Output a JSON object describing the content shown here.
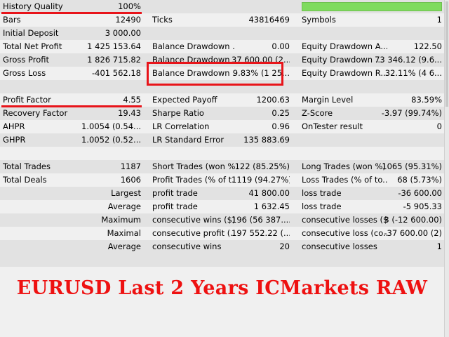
{
  "rows": [
    {
      "c1": "History Quality",
      "v1": "100%"
    },
    {
      "c1": "Bars",
      "v1": "12490",
      "c2": "Ticks",
      "v2": "43816469",
      "c3": "Symbols",
      "v3": "1"
    },
    {
      "c1": "Initial Deposit",
      "v1": "3 000.00"
    },
    {
      "c1": "Total Net Profit",
      "v1": "1 425 153.64",
      "c2": "Balance Drawdown ...",
      "v2": "0.00",
      "c3": "Equity Drawdown A...",
      "v3": "122.50"
    },
    {
      "c1": "Gross Profit",
      "v1": "1 826 715.82",
      "c2": "Balance Drawdown ...",
      "v2": "37 600.00 (2...",
      "c3": "Equity Drawdown ...",
      "v3": "73 346.12 (9.6..."
    },
    {
      "c1": "Gross Loss",
      "v1": "-401 562.18",
      "c2": "Balance Drawdown ...",
      "v2": "9.83% (1 25...",
      "c3": "Equity Drawdown R...",
      "v3": "32.11% (4 6..."
    },
    {},
    {
      "c1": "Profit Factor",
      "v1": "4.55",
      "c2": "Expected Payoff",
      "v2": "1200.63",
      "c3": "Margin Level",
      "v3": "83.59%"
    },
    {
      "c1": "Recovery Factor",
      "v1": "19.43",
      "c2": "Sharpe Ratio",
      "v2": "0.25",
      "c3": "Z-Score",
      "v3": "-3.97 (99.74%)"
    },
    {
      "c1": "AHPR",
      "v1": "1.0054 (0.54...",
      "c2": "LR Correlation",
      "v2": "0.96",
      "c3": "OnTester result",
      "v3": "0"
    },
    {
      "c1": "GHPR",
      "v1": "1.0052 (0.52...",
      "c2": "LR Standard Error",
      "v2": "135 883.69"
    },
    {},
    {
      "c1": "Total Trades",
      "v1": "1187",
      "c2": "Short Trades (won %)",
      "v2": "122 (85.25%)",
      "c3": "Long Trades (won %)",
      "v3": "1065 (95.31%)"
    },
    {
      "c1": "Total Deals",
      "v1": "1606",
      "c2": "Profit Trades (% of t...",
      "v2": "1119 (94.27%)",
      "c3": "Loss Trades (% of to...",
      "v3": "68 (5.73%)"
    },
    {
      "v1": "Largest",
      "c2": "profit trade",
      "v2": "41 800.00",
      "c3": "loss trade",
      "v3": "-36 600.00"
    },
    {
      "v1": "Average",
      "c2": "profit trade",
      "v2": "1 632.45",
      "c3": "loss trade",
      "v3": "-5 905.33"
    },
    {
      "v1": "Maximum",
      "c2": "consecutive wins ($)",
      "v2": "196 (56 387....",
      "c3": "consecutive losses ($)",
      "v3": "3 (-12 600.00)"
    },
    {
      "v1": "Maximal",
      "c2": "consecutive profit (...",
      "v2": "197 552.22 (...",
      "c3": "consecutive loss (co...",
      "v3": "-37 600.00 (2)"
    },
    {
      "v1": "Average",
      "c2": "consecutive wins",
      "v2": "20",
      "c3": "consecutive losses",
      "v3": "1"
    }
  ],
  "quality": {
    "percent": 100,
    "color": "#7fdb5e"
  },
  "banner": "EURUSD Last 2 Years ICMarkets RAW",
  "colors": {
    "highlight": "#e8141a",
    "banner": "#ee1111"
  }
}
